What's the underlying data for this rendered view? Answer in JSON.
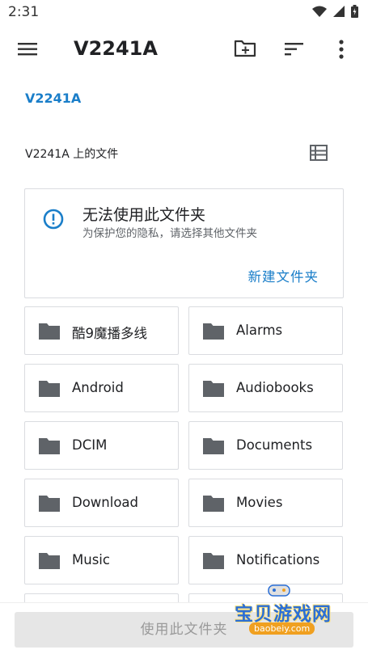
{
  "status_bar": {
    "time": "2:31"
  },
  "app_bar": {
    "title": "V2241A"
  },
  "breadcrumb": "V2241A",
  "files_header": "V2241A 上的文件",
  "warning": {
    "title": "无法使用此文件夹",
    "subtitle": "为保护您的隐私，请选择其他文件夹",
    "action": "新建文件夹"
  },
  "folders": [
    "酷9魔播多线",
    "Alarms",
    "Android",
    "Audiobooks",
    "DCIM",
    "Documents",
    "Download",
    "Movies",
    "Music",
    "Notifications",
    "",
    ""
  ],
  "bottom_button": "使用此文件夹",
  "watermark": {
    "text": "宝贝游戏网",
    "url": "baobeiy.com"
  },
  "colors": {
    "accent": "#1a7ec9",
    "icon": "#5f6368",
    "border": "#dadce0"
  }
}
